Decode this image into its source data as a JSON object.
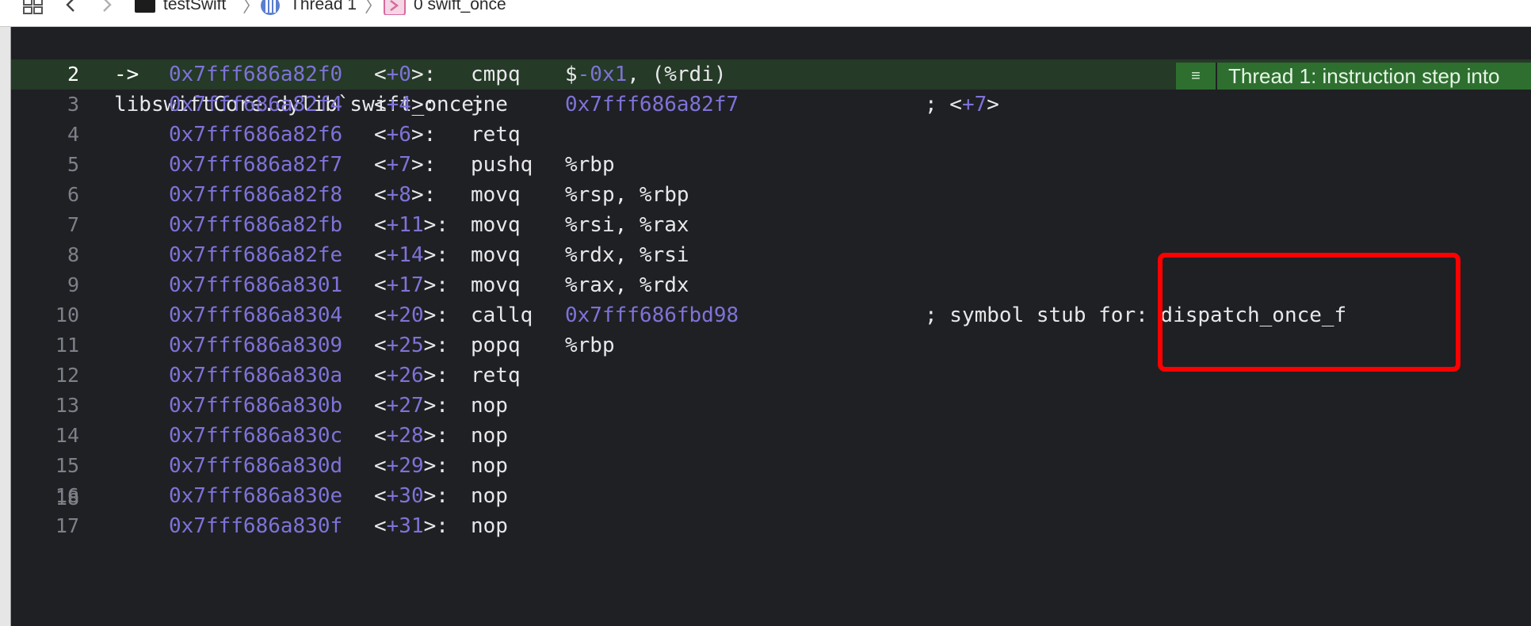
{
  "breadcrumbs": {
    "project": "testSwift",
    "thread": "Thread 1",
    "frame": "0 swift_once"
  },
  "banner": {
    "text": "Thread 1: instruction step into"
  },
  "editor": {
    "function_line": {
      "num": "1",
      "text": "libswiftCore.dylib`swift_once:"
    },
    "lines": [
      {
        "num": "2",
        "arrow": "->",
        "addr": "0x7fff686a82f0",
        "off": "+0",
        "mnemonic": "cmpq",
        "ops_pre": "$",
        "ops_num": "-0x1",
        "ops_post": ", (%rdi)",
        "comment": ""
      },
      {
        "num": "3",
        "arrow": "",
        "addr": "0x7fff686a82f4",
        "off": "+4",
        "mnemonic": "jne",
        "ops_pre": "",
        "ops_num": "0x7fff686a82f7",
        "ops_post": "",
        "comment": "; <+7>"
      },
      {
        "num": "4",
        "arrow": "",
        "addr": "0x7fff686a82f6",
        "off": "+6",
        "mnemonic": "retq",
        "ops_pre": "",
        "ops_num": "",
        "ops_post": "",
        "comment": ""
      },
      {
        "num": "5",
        "arrow": "",
        "addr": "0x7fff686a82f7",
        "off": "+7",
        "mnemonic": "pushq",
        "ops_pre": "%rbp",
        "ops_num": "",
        "ops_post": "",
        "comment": ""
      },
      {
        "num": "6",
        "arrow": "",
        "addr": "0x7fff686a82f8",
        "off": "+8",
        "mnemonic": "movq",
        "ops_pre": "%rsp, %rbp",
        "ops_num": "",
        "ops_post": "",
        "comment": ""
      },
      {
        "num": "7",
        "arrow": "",
        "addr": "0x7fff686a82fb",
        "off": "+11",
        "mnemonic": "movq",
        "ops_pre": "%rsi, %rax",
        "ops_num": "",
        "ops_post": "",
        "comment": ""
      },
      {
        "num": "8",
        "arrow": "",
        "addr": "0x7fff686a82fe",
        "off": "+14",
        "mnemonic": "movq",
        "ops_pre": "%rdx, %rsi",
        "ops_num": "",
        "ops_post": "",
        "comment": ""
      },
      {
        "num": "9",
        "arrow": "",
        "addr": "0x7fff686a8301",
        "off": "+17",
        "mnemonic": "movq",
        "ops_pre": "%rax, %rdx",
        "ops_num": "",
        "ops_post": "",
        "comment": ""
      },
      {
        "num": "10",
        "arrow": "",
        "addr": "0x7fff686a8304",
        "off": "+20",
        "mnemonic": "callq",
        "ops_pre": "",
        "ops_num": "0x7fff686fbd98",
        "ops_post": "",
        "comment": "; symbol stub for: dispatch_once_f"
      },
      {
        "num": "11",
        "arrow": "",
        "addr": "0x7fff686a8309",
        "off": "+25",
        "mnemonic": "popq",
        "ops_pre": "%rbp",
        "ops_num": "",
        "ops_post": "",
        "comment": ""
      },
      {
        "num": "12",
        "arrow": "",
        "addr": "0x7fff686a830a",
        "off": "+26",
        "mnemonic": "retq",
        "ops_pre": "",
        "ops_num": "",
        "ops_post": "",
        "comment": ""
      },
      {
        "num": "13",
        "arrow": "",
        "addr": "0x7fff686a830b",
        "off": "+27",
        "mnemonic": "nop",
        "ops_pre": "",
        "ops_num": "",
        "ops_post": "",
        "comment": ""
      },
      {
        "num": "14",
        "arrow": "",
        "addr": "0x7fff686a830c",
        "off": "+28",
        "mnemonic": "nop",
        "ops_pre": "",
        "ops_num": "",
        "ops_post": "",
        "comment": ""
      },
      {
        "num": "15",
        "arrow": "",
        "addr": "0x7fff686a830d",
        "off": "+29",
        "mnemonic": "nop",
        "ops_pre": "",
        "ops_num": "",
        "ops_post": "",
        "comment": ""
      },
      {
        "num": "16",
        "arrow": "",
        "addr": "0x7fff686a830e",
        "off": "+30",
        "mnemonic": "nop",
        "ops_pre": "",
        "ops_num": "",
        "ops_post": "",
        "comment": ""
      },
      {
        "num": "17",
        "arrow": "",
        "addr": "0x7fff686a830f",
        "off": "+31",
        "mnemonic": "nop",
        "ops_pre": "",
        "ops_num": "",
        "ops_post": "",
        "comment": ""
      }
    ],
    "last_line": {
      "num": "18"
    }
  },
  "colors": {
    "background": "#1f2024",
    "current_line": "#253a27",
    "address": "#7e73d8",
    "banner": "#2e6f2f",
    "highlight": "#ff0000"
  }
}
